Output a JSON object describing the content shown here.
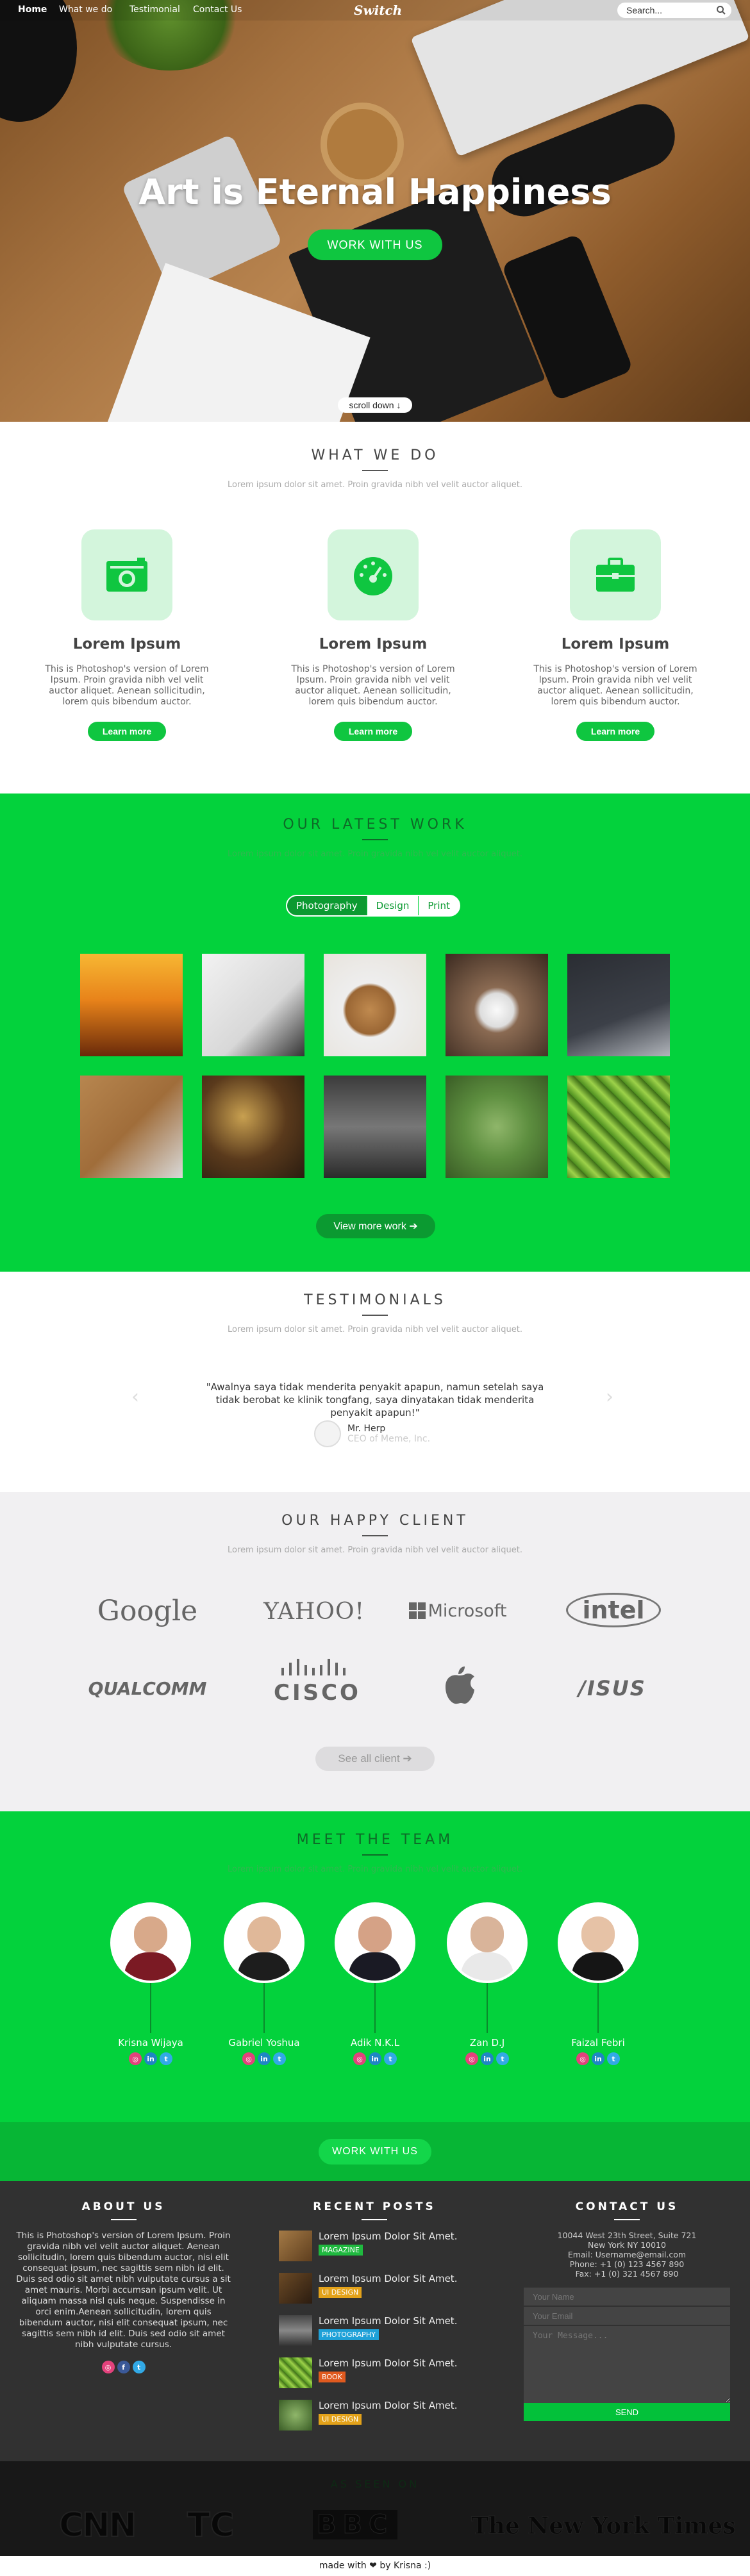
{
  "nav": {
    "home": "Home",
    "what_we_do": "What we do",
    "testimonials": "Testimonial",
    "contact": "Contact Us",
    "logo": "Switch",
    "search_placeholder": "Search..."
  },
  "hero": {
    "title": "Art is Eternal Happiness",
    "cta": "WORK WITH US",
    "scroll": "scroll down ↓"
  },
  "what_we_do": {
    "title": "WHAT WE DO",
    "subtitle": "Lorem ipsum dolor sit amet. Proin gravida nibh vel velit auctor aliquet.",
    "services": [
      {
        "icon": "camera-icon",
        "title": "Lorem Ipsum",
        "text": "This is Photoshop's version  of Lorem Ipsum. Proin gravida nibh vel velit auctor aliquet. Aenean sollicitudin, lorem quis bibendum auctor.",
        "button": "Learn more"
      },
      {
        "icon": "speedometer-icon",
        "title": "Lorem Ipsum",
        "text": "This is Photoshop's version  of Lorem Ipsum. Proin gravida nibh vel velit auctor aliquet. Aenean sollicitudin, lorem quis bibendum auctor.",
        "button": "Learn more"
      },
      {
        "icon": "briefcase-icon",
        "title": "Lorem Ipsum",
        "text": "This is Photoshop's version  of Lorem Ipsum. Proin gravida nibh vel velit auctor aliquet. Aenean sollicitudin, lorem quis bibendum auctor.",
        "button": "Learn more"
      }
    ]
  },
  "work": {
    "title": "OUR LATEST WORK",
    "subtitle": "Lorem ipsum dolor sit amet. Proin gravida nibh vel velit auctor aliquet.",
    "tabs": [
      "Photography",
      "Design",
      "Print"
    ],
    "more": "View more work ➔"
  },
  "testimonials": {
    "title": "TESTIMONIALS",
    "subtitle": "Lorem ipsum dolor sit amet. Proin gravida nibh vel velit auctor aliquet.",
    "quote": "\"Awalnya saya tidak menderita penyakit apapun, namun setelah saya tidak berobat ke klinik tongfang, saya dinyatakan tidak menderita penyakit apapun!\"",
    "author": "Mr. Herp",
    "role": "CEO of Meme, Inc."
  },
  "clients": {
    "title": "OUR HAPPY CLIENT",
    "subtitle": "Lorem ipsum dolor sit amet. Proin gravida nibh vel velit auctor aliquet.",
    "logos": [
      "Google",
      "YAHOO!",
      "Microsoft",
      "intel",
      "QUALCOMM",
      "CISCO",
      "",
      "/ISUS"
    ],
    "see_all": "See all client  ➔"
  },
  "team": {
    "title": "MEET THE TEAM",
    "subtitle": "Lorem ipsum dolor sit amet. Proin gravida nibh vel velit auctor aliquet.",
    "members": [
      "Krisna Wijaya",
      "Gabriel Yoshua",
      "Adik N.K.L",
      "Zan D.J",
      "Faizal Febri"
    ]
  },
  "cta": {
    "label": "WORK WITH US"
  },
  "footer": {
    "about_title": "ABOUT US",
    "about_text": "This is Photoshop's version  of Lorem Ipsum. Proin gravida nibh vel velit auctor aliquet. Aenean sollicitudin, lorem quis bibendum auctor, nisi elit consequat ipsum, nec sagittis sem nibh id elit. Duis sed odio sit amet nibh vulputate cursus a sit amet mauris. Morbi accumsan ipsum velit. Ut aliquam massa nisl quis neque. Suspendisse in orci enim.Aenean sollicitudin, lorem quis bibendum auctor, nisi elit consequat ipsum, nec sagittis sem nibh id elit. Duis sed odio sit amet nibh vulputate cursus.",
    "posts_title": "RECENT POSTS",
    "posts": [
      {
        "title": "Lorem Ipsum Dolor Sit Amet.",
        "tag": "MAGAZINE",
        "color": "#1fb93f"
      },
      {
        "title": "Lorem Ipsum Dolor Sit Amet.",
        "tag": "UI DESIGN",
        "color": "#e3a21a"
      },
      {
        "title": "Lorem Ipsum Dolor Sit Amet.",
        "tag": "PHOTOGRAPHY",
        "color": "#1fa1d8"
      },
      {
        "title": "Lorem Ipsum Dolor Sit Amet.",
        "tag": "BOOK",
        "color": "#e05a1f"
      },
      {
        "title": "Lorem Ipsum Dolor Sit Amet.",
        "tag": "UI DESIGN",
        "color": "#e3a21a"
      }
    ],
    "contact_title": "CONTACT US",
    "address1": "10044 West 23th Street, Suite 721",
    "address2": "New York NY 10010",
    "email": "Email: Username@email.com",
    "phone": "Phone: +1 (0) 123 4567 890",
    "fax": "Fax: +1 (0) 321 4567 890",
    "name_ph": "Your Name",
    "email_ph": "Your Email",
    "message_ph": "Your Message...",
    "send": "SEND"
  },
  "seen_on": {
    "title": "AS SEEN ON",
    "brands": [
      "CNN",
      "TC",
      "BBC",
      "The New York Times"
    ]
  },
  "made_with": "made with ❤ by Krisna :)"
}
